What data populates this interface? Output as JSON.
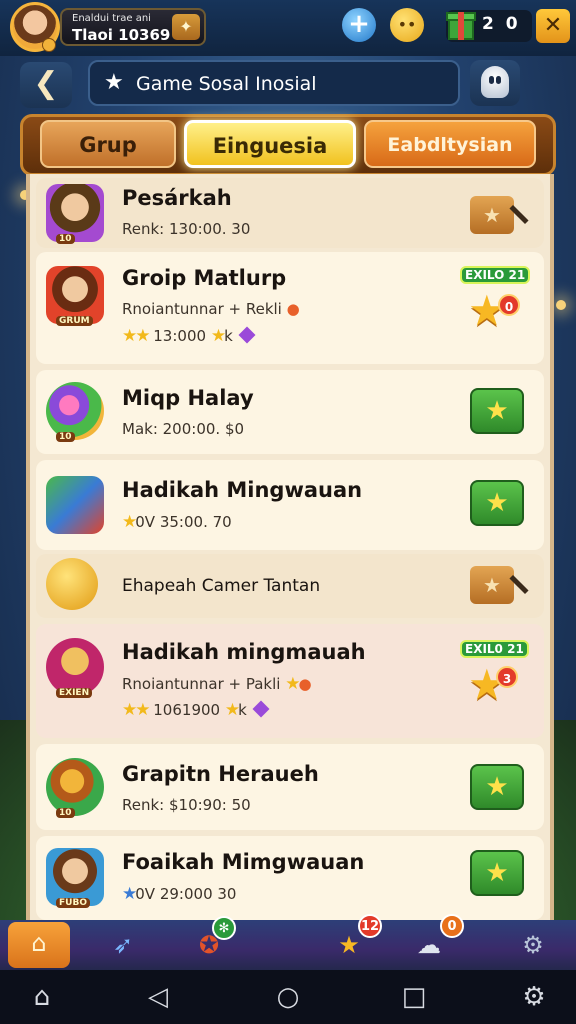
{
  "topbar": {
    "profile_line1": "Enaldui trae ani",
    "profile_line2": "Tlaoi 10369",
    "resource_value": "2 0",
    "close_label": "✕"
  },
  "header": {
    "back_label": "❮",
    "search_text": "Game Sosal Inosial"
  },
  "tabs": [
    {
      "label": "Grup"
    },
    {
      "label": "Einguesia"
    },
    {
      "label": "Eabdltysian"
    }
  ],
  "list": [
    {
      "title": "Pesárkah",
      "sub": "Renk: 130:00. 30",
      "tag": "10"
    },
    {
      "title": "Groip Matlurp",
      "sub": "Rnoiantunnar + Rekli",
      "sub2": "13:000",
      "sub2_suffix": "k",
      "tag": "GRUM",
      "badge": "EXILO 21",
      "star_badge": "0"
    },
    {
      "title": "Miqp Halay",
      "sub": "Mak: 200:00. $0",
      "tag": "10"
    },
    {
      "title": "Hadikah Mingwauan",
      "sub_prefix": "0V",
      "sub": "35:00. 70"
    },
    {
      "title": "Ehapeah Camer Tantan"
    },
    {
      "title": "Hadikah mingmauah",
      "sub": "Rnoiantunnar + Pakli",
      "sub2": "1061900",
      "sub2_suffix": "k",
      "tag": "EXIEN",
      "badge": "EXIL0 21",
      "star_badge": "3"
    },
    {
      "title": "Grapitn Heraueh",
      "sub": "Renk: $10:90: 50",
      "tag": "10"
    },
    {
      "title": "Foaikah Mimgwauan",
      "sub_prefix": "0V",
      "sub": "29:000 30",
      "tag": "FUBO"
    }
  ],
  "bottom_nav": {
    "badge_gift": "✻",
    "badge_star": "12",
    "badge_chat": "0"
  },
  "icons": {
    "home": "home-icon",
    "rocket": "rocket-icon",
    "gift": "gift-icon",
    "star": "star-icon",
    "chat": "chat-icon",
    "settings": "gear-icon"
  },
  "colors": {
    "accent_yellow": "#f1c21f",
    "panel": "#f4e8d2",
    "green_button": "#3f9f33",
    "navbar": "#2d3f78"
  }
}
